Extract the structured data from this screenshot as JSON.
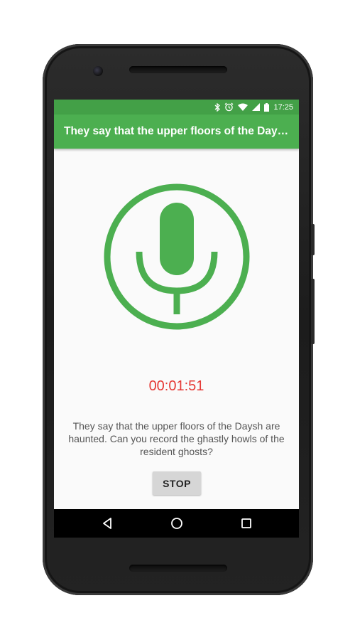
{
  "status_bar": {
    "time": "17:25",
    "icons": [
      "bluetooth-icon",
      "alarm-icon",
      "wifi-icon",
      "signal-icon",
      "battery-icon"
    ],
    "color": "#43a047"
  },
  "app_bar": {
    "title": "They say that the upper floors of the Daysh are haunted. Can you record the ghastly howls of the resident ghosts?",
    "color": "#4caf50"
  },
  "recorder": {
    "icon": "microphone-icon",
    "timer": "00:01:51",
    "timer_color": "#e53935",
    "prompt": "They say that the upper floors of the Daysh are haunted. Can you record the ghastly howls of the resident ghosts?",
    "stop_label": "STOP"
  },
  "nav_bar": {
    "icons": [
      "back-icon",
      "home-icon",
      "recents-icon"
    ]
  }
}
